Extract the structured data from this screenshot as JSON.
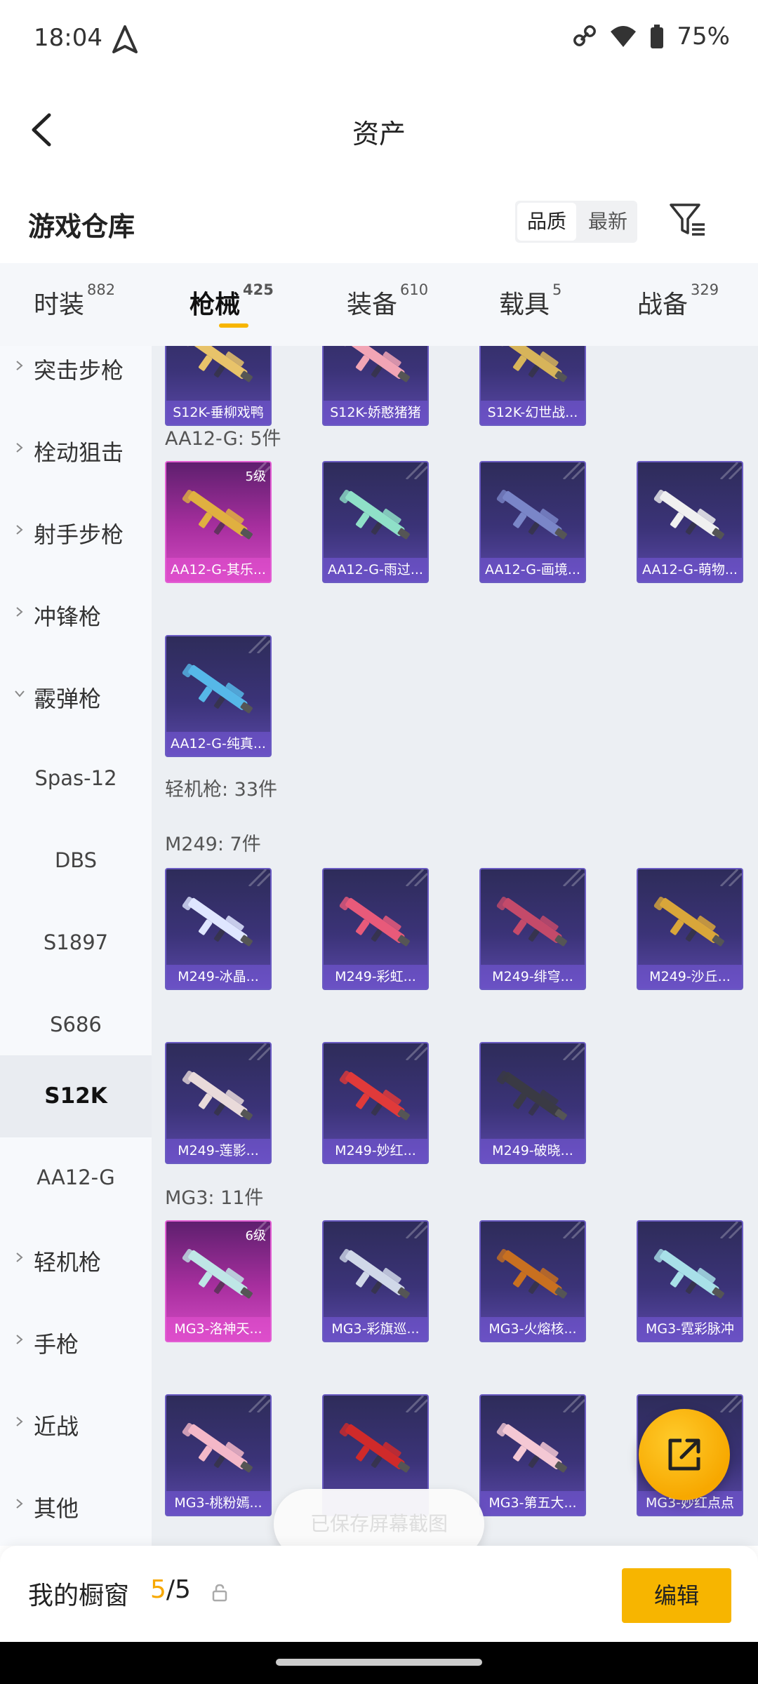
{
  "status_bar": {
    "time": "18:04",
    "battery": "75%"
  },
  "header": {
    "title": "资产"
  },
  "section": {
    "title": "游戏仓库",
    "sort_quality": "品质",
    "sort_latest": "最新"
  },
  "tabs": [
    {
      "label": "时装",
      "count": "882"
    },
    {
      "label": "枪械",
      "count": "425"
    },
    {
      "label": "装备",
      "count": "610"
    },
    {
      "label": "载具",
      "count": "5"
    },
    {
      "label": "战备",
      "count": "329"
    }
  ],
  "sidebar": {
    "items": [
      {
        "label": "突击步枪"
      },
      {
        "label": "栓动狙击"
      },
      {
        "label": "射手步枪"
      },
      {
        "label": "冲锋枪"
      },
      {
        "label": "霰弹枪"
      },
      {
        "label": "Spas-12"
      },
      {
        "label": "DBS"
      },
      {
        "label": "S1897"
      },
      {
        "label": "S686"
      },
      {
        "label": "S12K"
      },
      {
        "label": "AA12-G"
      },
      {
        "label": "轻机枪"
      },
      {
        "label": "手枪"
      },
      {
        "label": "近战"
      },
      {
        "label": "其他"
      }
    ]
  },
  "content": {
    "groups": [
      {
        "label": "AA12-G: 5件"
      },
      {
        "label": "轻机枪: 33件"
      },
      {
        "label": "M249: 7件"
      },
      {
        "label": "MG3: 11件"
      }
    ],
    "cards": [
      {
        "name": "S12K-垂柳戏鸭"
      },
      {
        "name": "S12K-娇憨猪猪"
      },
      {
        "name": "S12K-幻世战..."
      },
      {
        "name": "AA12-G-其乐...",
        "level": "5级"
      },
      {
        "name": "AA12-G-雨过..."
      },
      {
        "name": "AA12-G-画境..."
      },
      {
        "name": "AA12-G-萌物..."
      },
      {
        "name": "AA12-G-纯真..."
      },
      {
        "name": "M249-冰晶..."
      },
      {
        "name": "M249-彩虹..."
      },
      {
        "name": "M249-绯穹..."
      },
      {
        "name": "M249-沙丘..."
      },
      {
        "name": "M249-莲影..."
      },
      {
        "name": "M249-妙红..."
      },
      {
        "name": "M249-破晓..."
      },
      {
        "name": "MG3-洛神天...",
        "level": "6级"
      },
      {
        "name": "MG3-彩旗巡..."
      },
      {
        "name": "MG3-火熔核..."
      },
      {
        "name": "MG3-霓彩脉冲"
      },
      {
        "name": "MG3-桃粉嫣..."
      },
      {
        "name": ""
      },
      {
        "name": "MG3-第五大..."
      },
      {
        "name": "MG3-妙红点点"
      }
    ]
  },
  "toast": {
    "text": "已保存屏幕截图"
  },
  "bottom_bar": {
    "label": "我的橱窗",
    "count_current": "5",
    "count_total": "/5",
    "edit_label": "编辑"
  },
  "colors": {
    "accent": "#f7b500",
    "card_purple": "#3b3378",
    "card_pink": "#d44cc4"
  }
}
